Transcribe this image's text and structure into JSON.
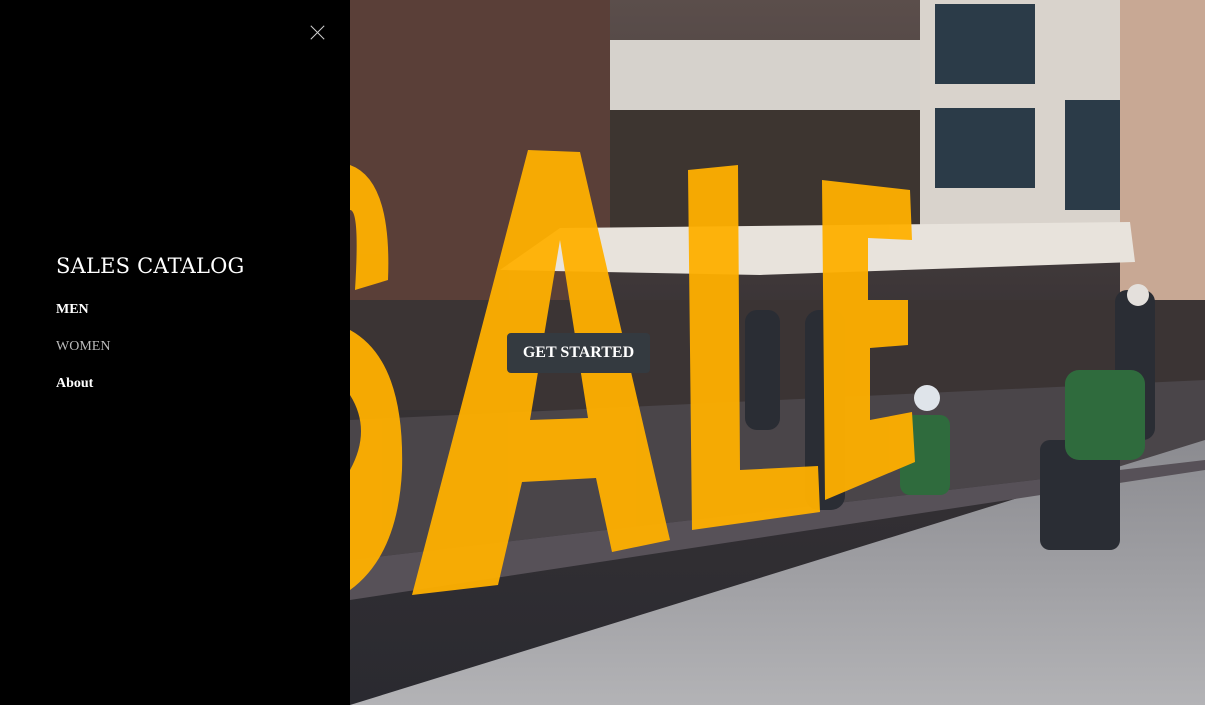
{
  "sidebar": {
    "brand": "SALES CATALOG",
    "close_icon": "close-icon",
    "items": [
      {
        "label": "MEN",
        "state": "default"
      },
      {
        "label": "WOMEN",
        "state": "muted"
      },
      {
        "label": "About",
        "state": "default"
      }
    ]
  },
  "hero": {
    "background": "photo-street-storefront",
    "window_text": "SALE",
    "cta_label": "GET STARTED"
  },
  "colors": {
    "sidebar_bg": "#000000",
    "cta_bg": "#343a40",
    "sale_yellow": "#ffb000",
    "muted_link": "#b9b9b9"
  }
}
